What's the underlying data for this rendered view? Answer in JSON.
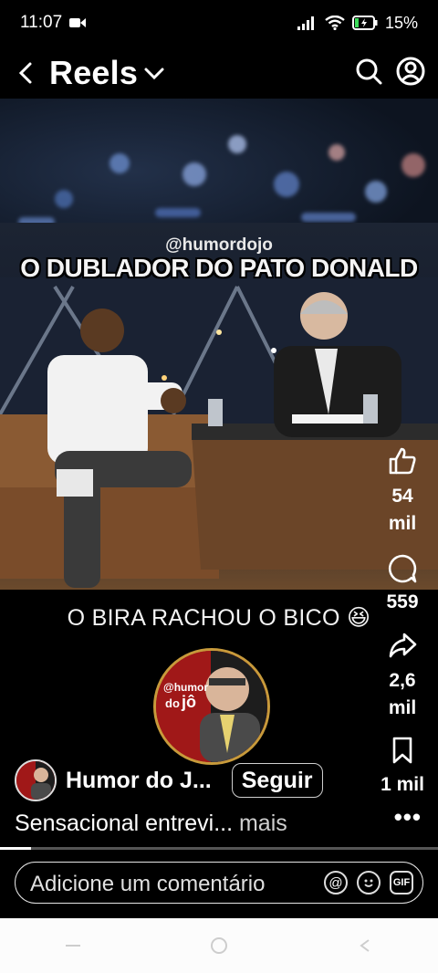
{
  "status": {
    "time": "11:07",
    "battery": "15%"
  },
  "header": {
    "title": "Reels"
  },
  "video": {
    "watermark": "@humordojo",
    "headline": "O DUBLADOR DO PATO DONALD",
    "caption": "O BIRA RACHOU O BICO 😆",
    "avatar_text_1": "@humor",
    "avatar_text_2": "do",
    "avatar_text_3": "jô"
  },
  "rail": {
    "likes_line1": "54",
    "likes_line2": "mil",
    "comments": "559",
    "shares_line1": "2,6",
    "shares_line2": "mil",
    "saves": "1 mil"
  },
  "account": {
    "name": "Humor do J...",
    "follow_label": "Seguir",
    "description": "Sensacional entrevi...",
    "more_label": "mais"
  },
  "comment": {
    "placeholder": "Adicione um comentário"
  },
  "playback": {
    "progress": 0.07
  },
  "colors": {
    "accent_gold": "#c79a3b",
    "avatar_red": "#a01818"
  }
}
